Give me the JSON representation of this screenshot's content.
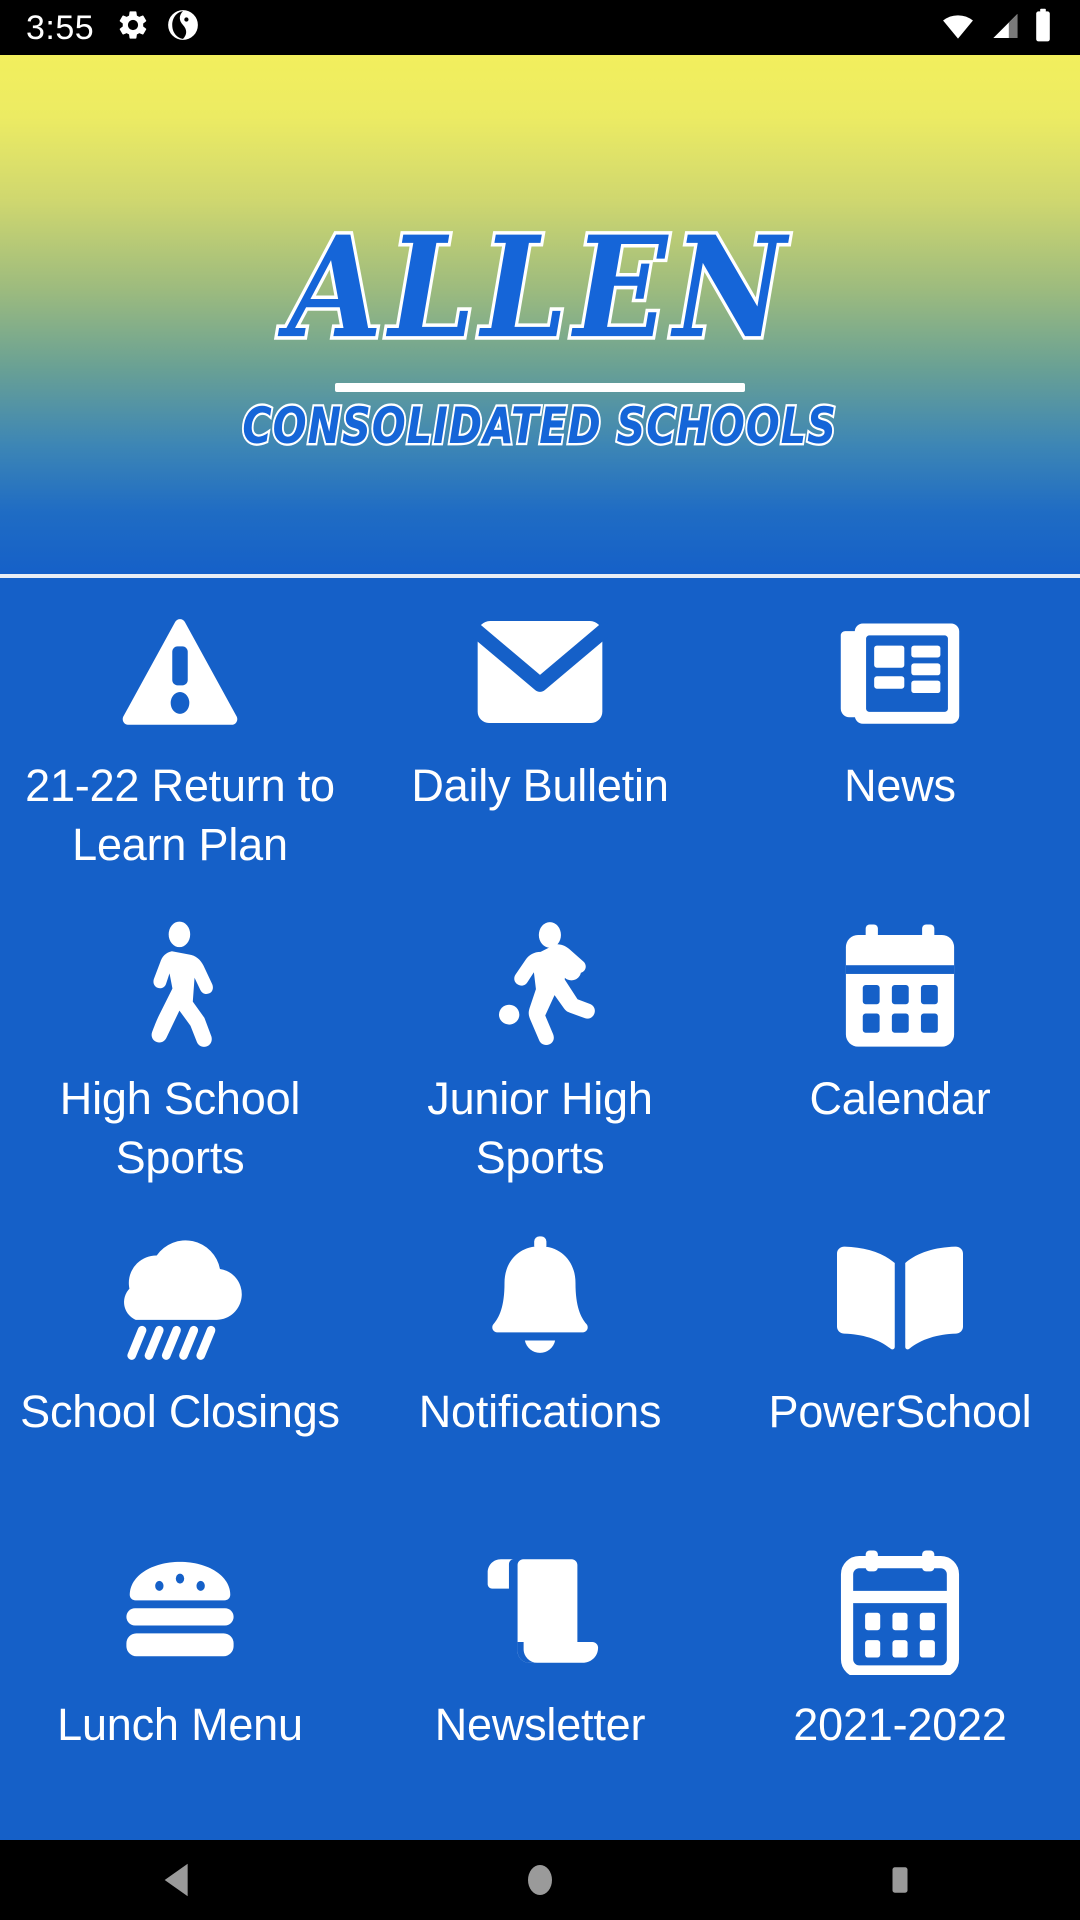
{
  "status_bar": {
    "time": "3:55",
    "left_icons": [
      "gear-icon",
      "swirl-app-icon"
    ],
    "right_icons": [
      "wifi-icon",
      "cellular-signal-icon",
      "battery-icon"
    ]
  },
  "header": {
    "logo_title": "ALLEN",
    "logo_subtitle": "CONSOLIDATED SCHOOLS",
    "gradient_top": "#f2ef5d",
    "gradient_bottom": "#1560c8"
  },
  "theme": {
    "background_blue": "#1560c8",
    "icon_white": "#ffffff",
    "logo_blue": "#1565d8",
    "status_bar_black": "#000000"
  },
  "grid": {
    "tiles": [
      {
        "label": "21-22 Return to Learn Plan",
        "icon": "warning-triangle-icon"
      },
      {
        "label": "Daily Bulletin",
        "icon": "envelope-icon"
      },
      {
        "label": "News",
        "icon": "newspaper-icon"
      },
      {
        "label": "High School Sports",
        "icon": "walking-person-icon"
      },
      {
        "label": "Junior High Sports",
        "icon": "running-person-icon"
      },
      {
        "label": "Calendar",
        "icon": "calendar-filled-icon"
      },
      {
        "label": "School Closings",
        "icon": "rain-cloud-icon"
      },
      {
        "label": "Notifications",
        "icon": "bell-icon"
      },
      {
        "label": "PowerSchool",
        "icon": "open-book-icon"
      },
      {
        "label": "Lunch Menu",
        "icon": "hamburger-food-icon"
      },
      {
        "label": "Newsletter",
        "icon": "scroll-icon"
      },
      {
        "label": "2021-2022",
        "icon": "calendar-outline-icon"
      }
    ]
  },
  "nav_bar": {
    "back_label": "Back",
    "home_label": "Home",
    "recents_label": "Recent apps"
  }
}
